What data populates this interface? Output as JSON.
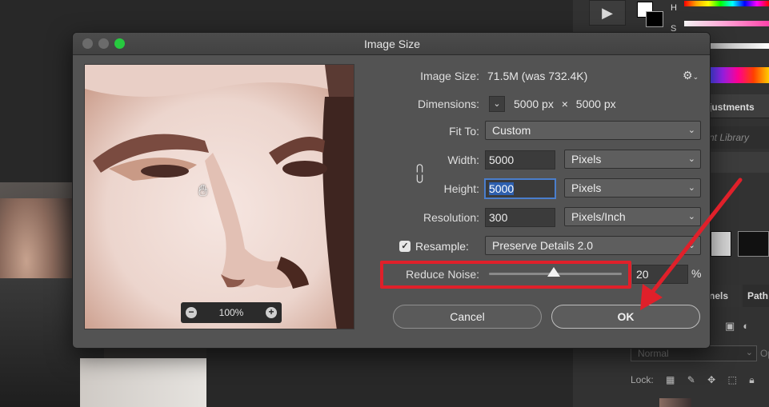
{
  "dialog": {
    "title": "Image Size",
    "image_size_label": "Image Size:",
    "image_size_value": "71.5M (was 732.4K)",
    "dimensions_label": "Dimensions:",
    "dimensions_width": "5000 px",
    "dimensions_x": "×",
    "dimensions_height": "5000 px",
    "fit_to_label": "Fit To:",
    "fit_to_value": "Custom",
    "width_label": "Width:",
    "width_value": "5000",
    "width_unit": "Pixels",
    "height_label": "Height:",
    "height_value": "5000",
    "height_unit": "Pixels",
    "resolution_label": "Resolution:",
    "resolution_value": "300",
    "resolution_unit": "Pixels/Inch",
    "resample_label": "Resample:",
    "resample_checked": true,
    "resample_value": "Preserve Details 2.0",
    "reduce_noise_label": "Reduce Noise:",
    "reduce_noise_value": "20",
    "reduce_noise_level": 0.2,
    "percent_sign": "%",
    "cancel_label": "Cancel",
    "ok_label": "OK",
    "preview_zoom": "100%",
    "zoom_minus": "−",
    "zoom_plus": "+"
  },
  "right_panel": {
    "hue_label": "H",
    "sat_label": "S",
    "adjustments_tab": "justments",
    "library_label": "nt Library",
    "channels_tab": "nels",
    "paths_tab": "Path",
    "blend_mode": "Normal",
    "opacity_label": "Op",
    "lock_label": "Lock:"
  },
  "colors": {
    "annotation_red": "#e0202a",
    "dialog_bg": "#535353",
    "focus_blue": "#4a7ecc"
  }
}
